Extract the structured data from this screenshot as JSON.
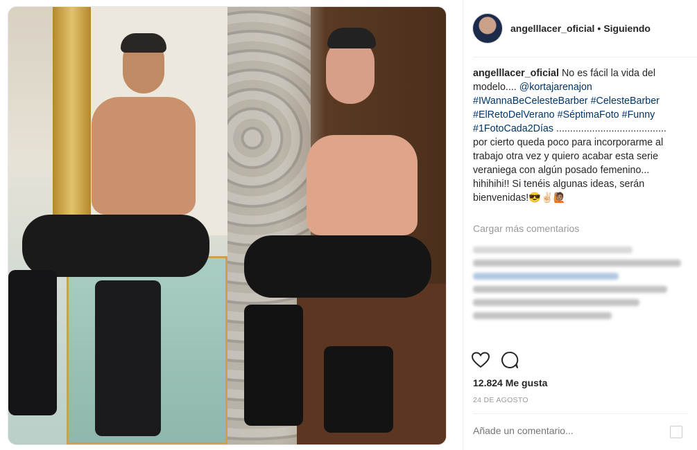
{
  "post": {
    "username": "angelllacer_oficial",
    "follow_status": "Siguiendo",
    "separator": "•",
    "caption_username": "angelllacer_oficial",
    "caption_text_1": " No es fácil la vida del modelo.... ",
    "mention": "@kortajarenajon",
    "hashtags": [
      "#IWannaBeCelesteBarber",
      "#CelesteBarber",
      "#ElRetoDelVerano",
      "#SéptimaFoto",
      "#Funny",
      "#1FotoCada2Días"
    ],
    "caption_text_2": " ........................................ por cierto queda poco para incorporarme al trabajo otra vez y quiero acabar esta serie veraniega con algún posado femenino... hihihihi!! Si tenéis algunas ideas, serán bienvenidas!😎✌🏻🙋🏽",
    "load_more": "Cargar más comentarios",
    "likes": "12.824 Me gusta",
    "date": "24 DE AGOSTO",
    "comment_placeholder": "Añade un comentario..."
  },
  "icons": {
    "like": "heart-icon",
    "comment": "comment-icon",
    "options": "more-icon"
  }
}
